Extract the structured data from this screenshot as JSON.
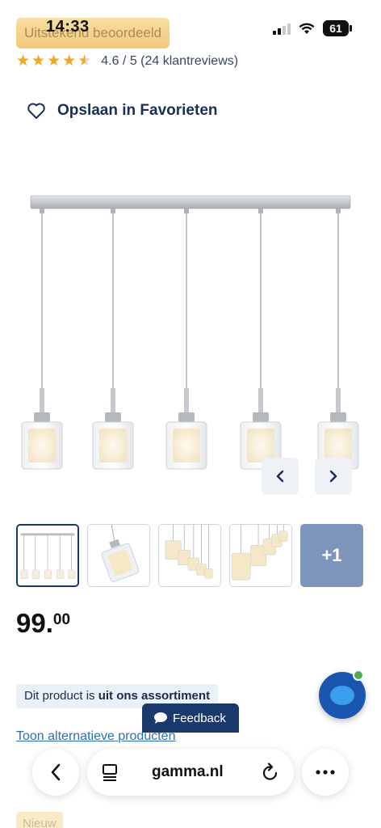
{
  "status_bar": {
    "time": "14:33",
    "battery": "61",
    "overlay_badge": "Uitstekend beoordeeld"
  },
  "rating": {
    "score_value": 4.6,
    "text": "4.6 / 5 (24 klantreviews)",
    "star_color": "#f0a91d"
  },
  "favorite": {
    "label": "Opslaan in Favorieten",
    "icon": "heart-outline-icon"
  },
  "gallery": {
    "prev_icon": "chevron-left-icon",
    "next_icon": "chevron-right-icon",
    "more_label": "+1",
    "active_index": 0
  },
  "price": {
    "main": "99.",
    "cents": "00"
  },
  "availability": {
    "prefix": "Dit product is ",
    "emphasis": "uit ons assortiment"
  },
  "alternatives_link": "Toon alternatieve producten",
  "feedback_label": "Feedback",
  "browser": {
    "url": "gamma.nl",
    "back_icon": "chevron-left-icon",
    "tabs_icon": "page-icon",
    "reload_icon": "reload-icon",
    "more_icon": "more-dots-icon"
  },
  "bottom_badge": "Nieuw",
  "colors": {
    "brand_navy": "#1a3a6e",
    "link_blue": "#2d6fb7",
    "badge_gold": "#f2c879"
  }
}
